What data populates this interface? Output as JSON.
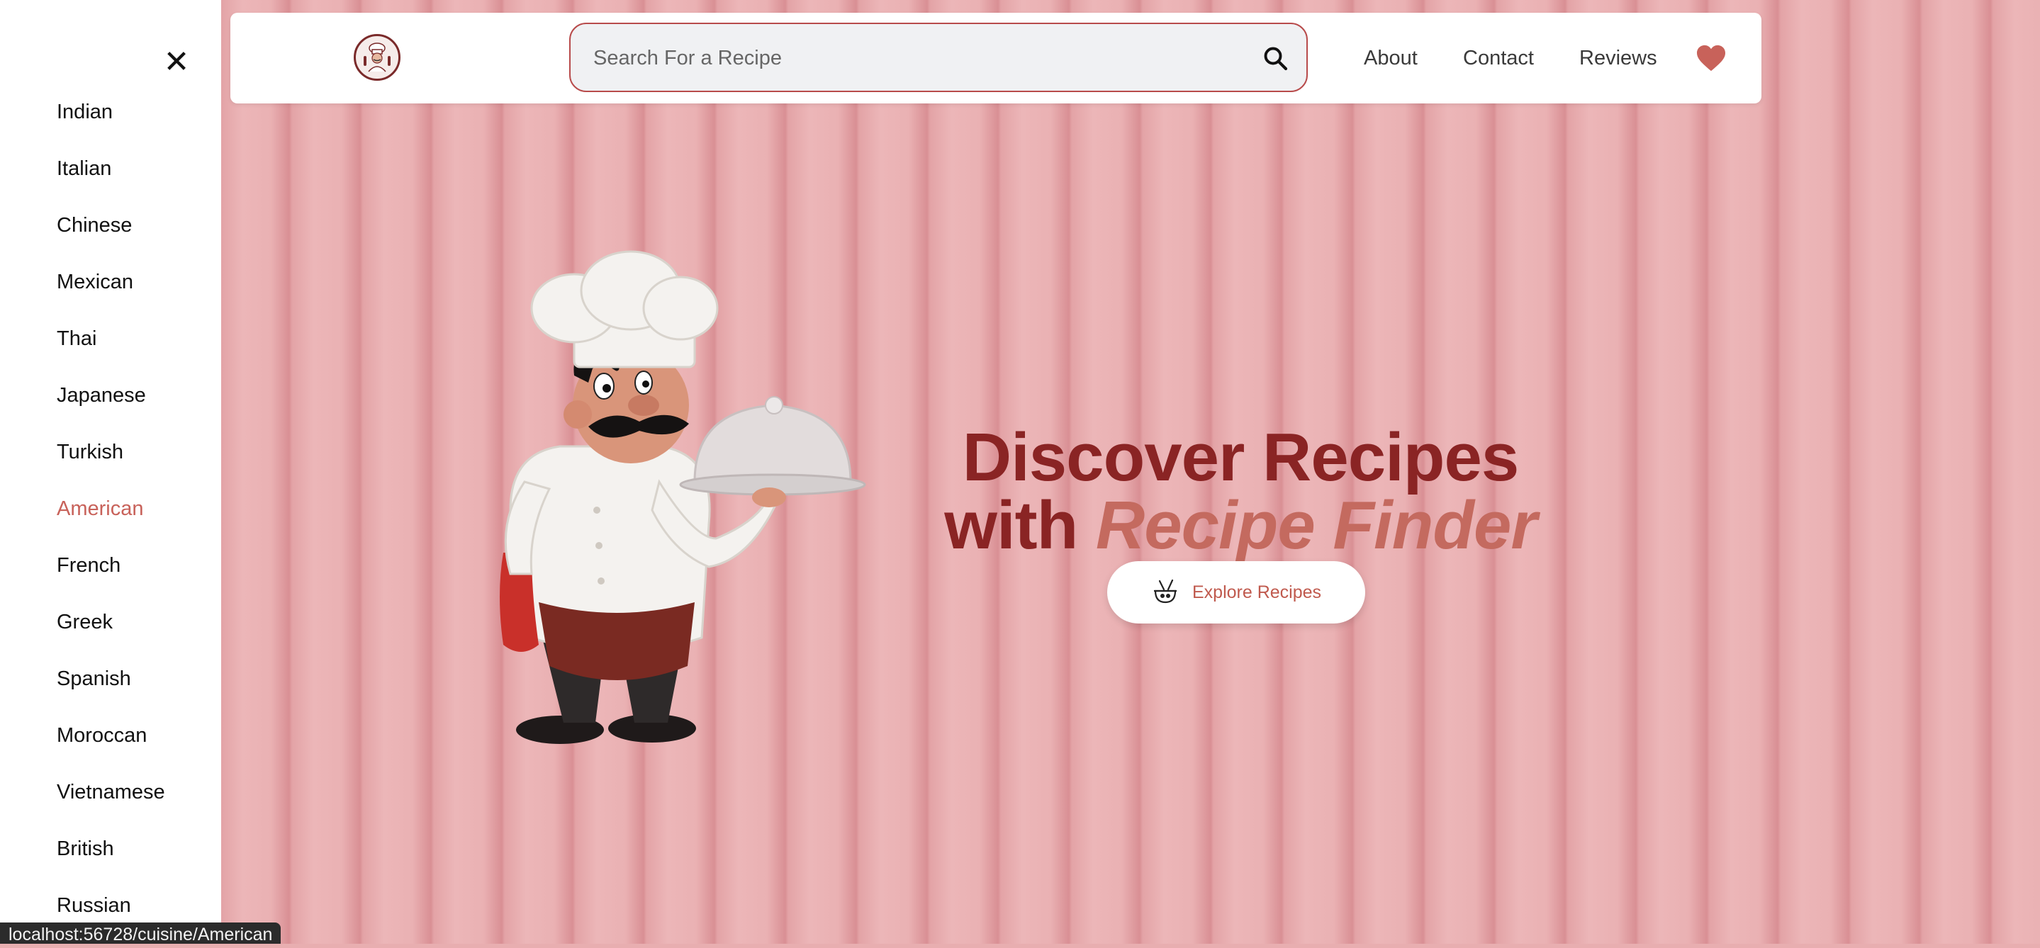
{
  "sidebar": {
    "close_icon": "close-icon",
    "items": [
      {
        "label": "Indian"
      },
      {
        "label": "Italian"
      },
      {
        "label": "Chinese"
      },
      {
        "label": "Mexican"
      },
      {
        "label": "Thai"
      },
      {
        "label": "Japanese"
      },
      {
        "label": "Turkish"
      },
      {
        "label": "American"
      },
      {
        "label": "French"
      },
      {
        "label": "Greek"
      },
      {
        "label": "Spanish"
      },
      {
        "label": "Moroccan"
      },
      {
        "label": "Vietnamese"
      },
      {
        "label": "British"
      },
      {
        "label": "Russian"
      }
    ],
    "active_item": "American",
    "active_color": "#c8625a"
  },
  "header": {
    "logo_icon": "chef-logo-icon",
    "search": {
      "placeholder": "Search For a Recipe",
      "value": "",
      "icon": "search-icon"
    },
    "nav": [
      {
        "label": "About"
      },
      {
        "label": "Contact"
      },
      {
        "label": "Reviews"
      }
    ],
    "favorites_icon": "heart-icon",
    "favorites_color": "#c8625a"
  },
  "hero": {
    "title_line1": "Discover Recipes",
    "title_line2_prefix": "with",
    "title_line2_accent": "Recipe Finder",
    "title_color": "#8a2424",
    "accent_color": "#c46a5f",
    "cta_label": "Explore Recipes",
    "cta_icon": "cooking-bowl-icon",
    "illustration": "chef-with-cloche-illustration"
  },
  "status_bar": {
    "url": "localhost:56728/cuisine/American"
  }
}
